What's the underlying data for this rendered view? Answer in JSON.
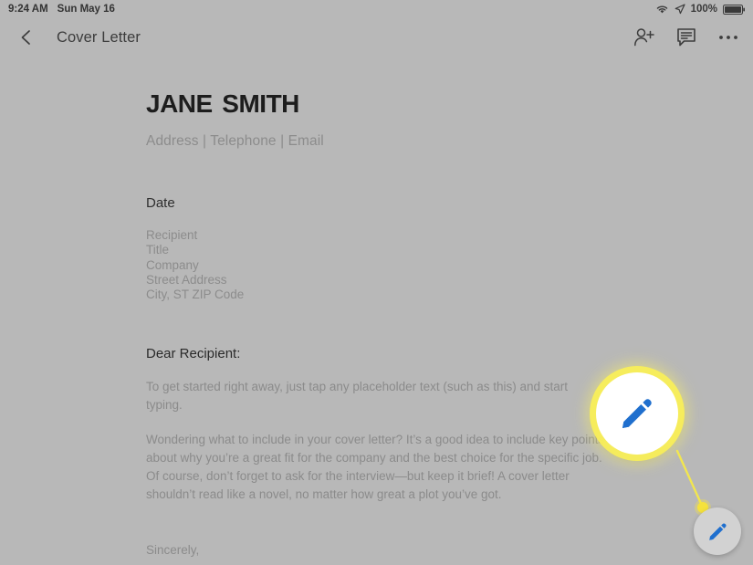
{
  "status_bar": {
    "time": "9:24 AM",
    "date": "Sun May 16",
    "battery_percent": "100%",
    "icons": {
      "wifi": "wifi-icon",
      "location": "location-arrow-icon",
      "battery": "battery-full-icon"
    }
  },
  "app_bar": {
    "back_label": "back-arrow",
    "title": "Cover Letter",
    "actions": [
      {
        "name": "add-person-icon",
        "label": "Share"
      },
      {
        "name": "comment-icon",
        "label": "Comments"
      },
      {
        "name": "overflow-menu-icon",
        "label": "More options"
      }
    ]
  },
  "document": {
    "name": "Jane Smith",
    "contact_line": "Address | Telephone | Email",
    "date_label": "Date",
    "recipient_block": [
      "Recipient",
      "Title",
      "Company",
      "Street Address",
      "City, ST ZIP Code"
    ],
    "salutation": "Dear Recipient:",
    "paragraph_1": "To get started right away, just tap any placeholder text (such as this) and start typing.",
    "paragraph_2": "Wondering what to include in your cover letter? It’s a good idea to include key points about why you’re a great fit for the company and the best choice for the specific job. Of course, don’t forget to ask for the interview—but keep it brief! A cover letter shouldn’t read like a novel, no matter how great a plot you’ve got.",
    "closing": "Sincerely,"
  },
  "callout": {
    "magnifier_icon": "edit-pencil-icon",
    "highlight_color": "#f5ec55",
    "target_button": "edit-fab"
  },
  "fab": {
    "icon": "edit-pencil-icon",
    "label": "Edit",
    "icon_color": "#1f6fce",
    "background": "#d2d2d2"
  },
  "colors": {
    "page_background": "#b8b8b8",
    "heading_text": "#1d1d1d",
    "body_text": "#8b8b8b",
    "accent_blue": "#1f6fce",
    "callout_yellow": "#f5ec55"
  }
}
